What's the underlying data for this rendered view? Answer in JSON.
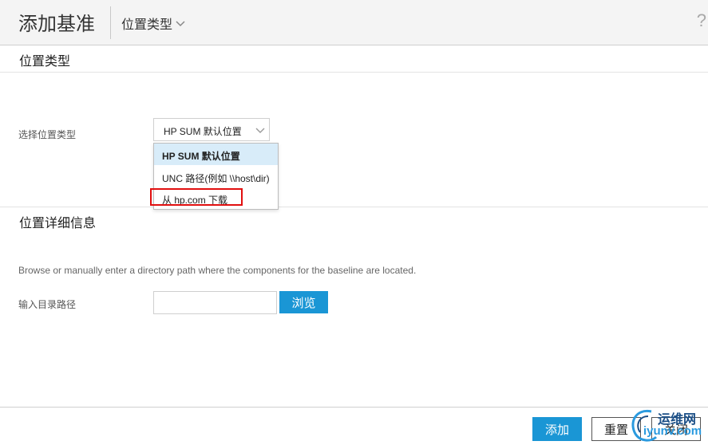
{
  "header": {
    "title": "添加基准",
    "nav_label": "位置类型",
    "help_label": "?"
  },
  "location_type_section": {
    "title": "位置类型",
    "select_label": "选择位置类型",
    "selected_value": "HP SUM 默认位置",
    "options": [
      "HP SUM 默认位置",
      "UNC 路径(例如 \\\\host\\dir)",
      "从 hp.com 下载"
    ],
    "highlighted_option_index": 2
  },
  "location_detail_section": {
    "title": "位置详细信息",
    "description": "Browse or manually enter a directory path where the components for the baseline are located.",
    "path_label": "输入目录路径",
    "path_value": "",
    "browse_label": "浏览"
  },
  "footer": {
    "add_label": "添加",
    "reset_label": "重置",
    "close_label": "关闭"
  },
  "watermark": {
    "cn": "运维网",
    "en": "iyunv.com"
  },
  "colors": {
    "accent": "#1a96d5",
    "highlight_border": "#e10f0f",
    "selected_option_bg": "#d8ecf9",
    "header_bg": "#f4f4f4"
  },
  "icons": [
    "chevron-down-icon",
    "help-icon"
  ]
}
